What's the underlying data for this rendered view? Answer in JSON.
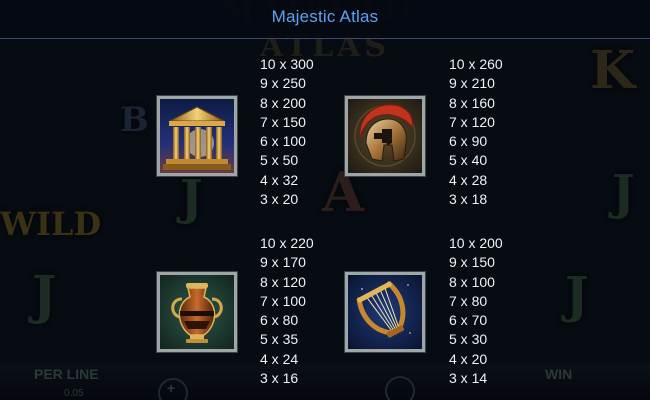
{
  "title": "Majestic Atlas",
  "background": {
    "frieze_text": "MAJESTIC ATLAS",
    "wild_label": "WILD",
    "per_line_label": "PER LINE",
    "per_line_value": "0.05",
    "win_label": "WIN",
    "plus_label": "+",
    "reel_letters": [
      "J",
      "A",
      "J",
      "K",
      "J",
      "J",
      "B"
    ]
  },
  "symbols": [
    {
      "name": "temple",
      "icon": "temple-icon",
      "payouts": [
        "10 x 300",
        "9 x 250",
        "8 x 200",
        "7 x 150",
        "6 x 100",
        "5 x 50",
        "4 x 32",
        "3 x 20"
      ]
    },
    {
      "name": "helmet",
      "icon": "spartan-helmet-icon",
      "payouts": [
        "10 x 260",
        "9 x 210",
        "8 x 160",
        "7 x 120",
        "6 x 90",
        "5 x 40",
        "4 x 28",
        "3 x 18"
      ]
    },
    {
      "name": "amphora",
      "icon": "amphora-icon",
      "payouts": [
        "10 x 220",
        "9 x 170",
        "8 x 120",
        "7 x 100",
        "6 x 80",
        "5 x 35",
        "4 x 24",
        "3 x 16"
      ]
    },
    {
      "name": "lyre",
      "icon": "lyre-icon",
      "payouts": [
        "10 x 200",
        "9 x 150",
        "8 x 100",
        "7 x 80",
        "6 x 70",
        "5 x 30",
        "4 x 20",
        "3 x 14"
      ]
    }
  ],
  "colors": {
    "title": "#5fa1ef",
    "frame": "#9fa6a8",
    "payout_text": "#f2f2f2",
    "background": "#070b12"
  }
}
